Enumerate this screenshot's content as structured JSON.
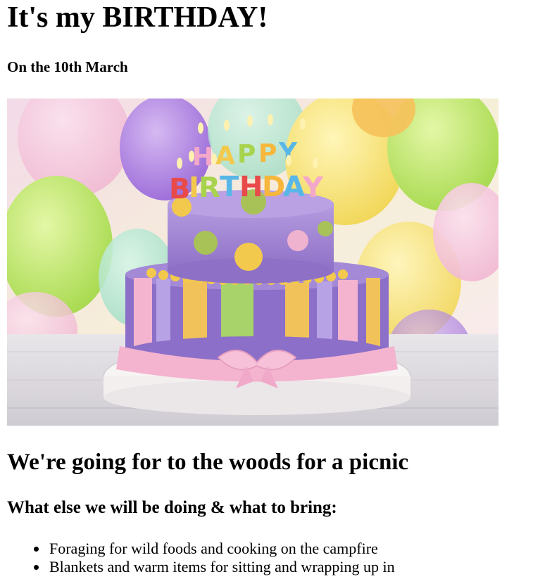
{
  "page": {
    "title": "It's my BIRTHDAY!",
    "date_line": "On the 10th March",
    "image": {
      "description_icon": "birthday-cake-photo",
      "candle_letters_top": "HAPPY",
      "candle_letters_bottom": "BIRTHDAY"
    },
    "subheading": "We're going for to the woods for a picnic",
    "list_heading": "What else we will be doing & what to bring:",
    "list_items": [
      "Foraging for wild foods and cooking on the campfire",
      "Blankets and warm items for sitting and wrapping up in"
    ]
  },
  "colors": {
    "text": "#000000",
    "background": "#ffffff",
    "cake_top": "#9b7fd0",
    "cake_bottom": "#8c6fc8",
    "ribbon_pink": "#f4b3cf",
    "dot_yellow": "#f2c94c",
    "dot_green": "#a8c257",
    "stripe_green": "#a7d36a",
    "stripe_yellow": "#f1c25a",
    "balloon_purple": "#b08be0",
    "balloon_green": "#b9e36a",
    "balloon_yellow": "#f6e47a"
  }
}
